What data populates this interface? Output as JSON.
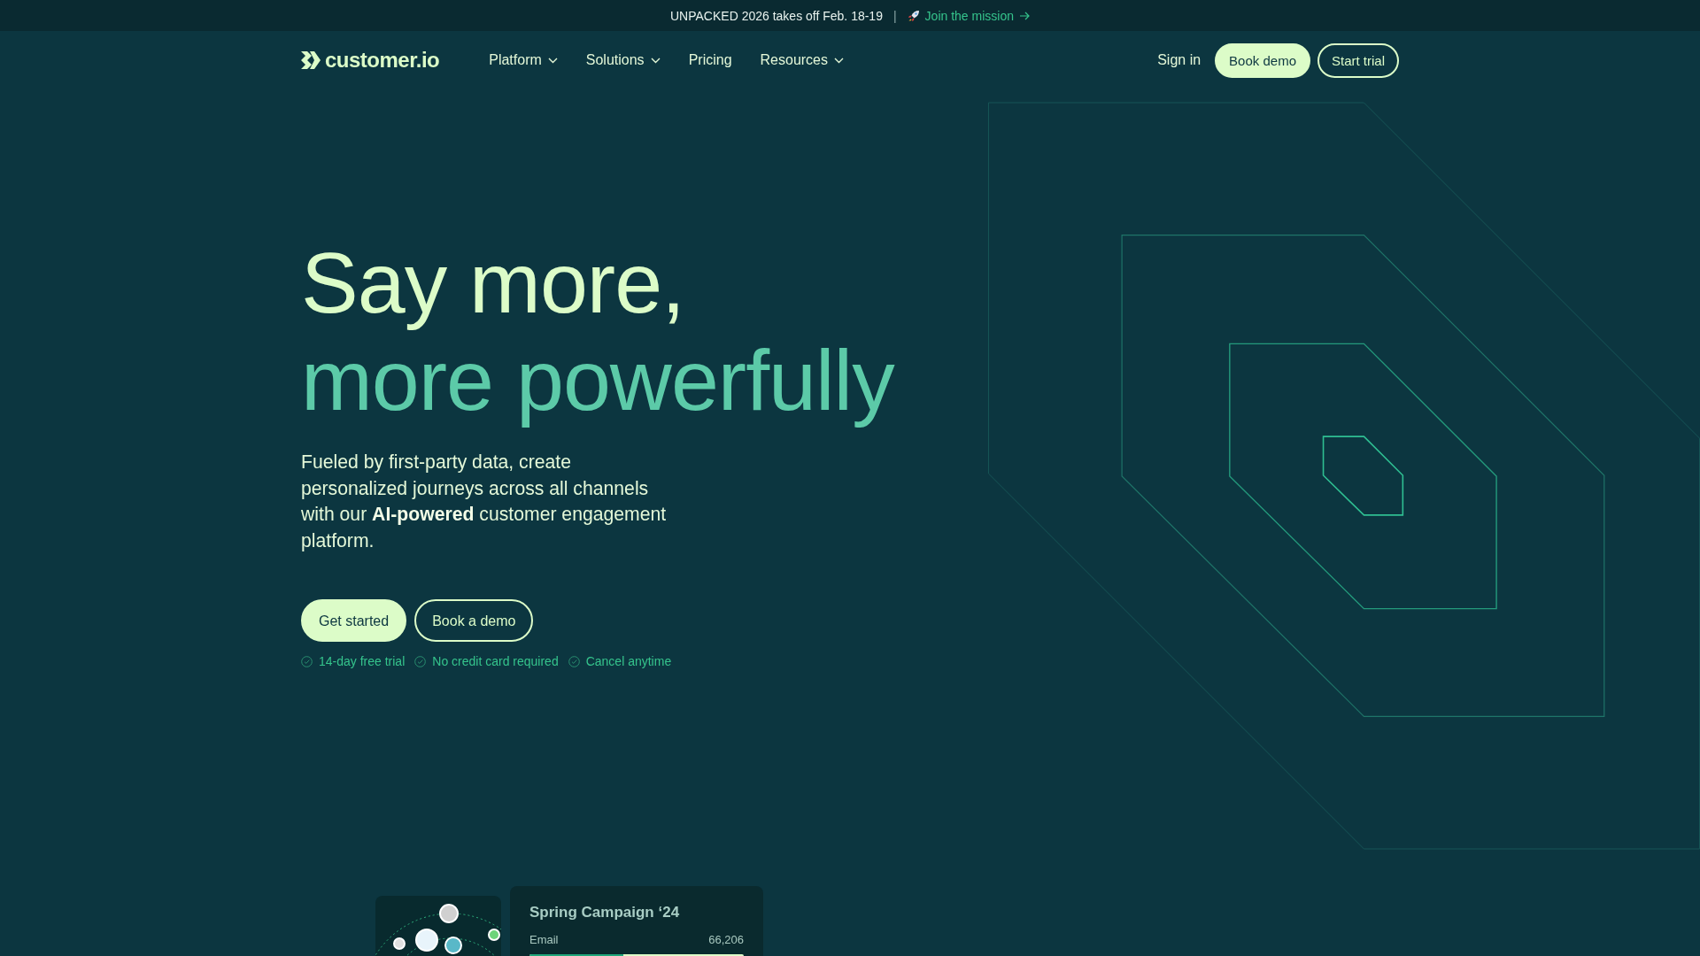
{
  "banner": {
    "text": "UNPACKED 2026 takes off Feb. 18-19",
    "separator": "|",
    "link": "Join the mission"
  },
  "nav": {
    "logo": "customer.io",
    "items": [
      {
        "label": "Platform",
        "dropdown": true
      },
      {
        "label": "Solutions",
        "dropdown": true
      },
      {
        "label": "Pricing",
        "dropdown": false
      },
      {
        "label": "Resources",
        "dropdown": true
      }
    ],
    "sign_in": "Sign in",
    "buttons": [
      {
        "label": "Book demo",
        "kind": "filled"
      },
      {
        "label": "Start trial",
        "kind": "outline"
      }
    ]
  },
  "hero": {
    "title_lines": [
      "Say more,",
      "more powerfully"
    ],
    "description": "Fueled by first-party data, create personalized journeys across all channels with our **AI-powered** customer engagement platform.",
    "buttons": [
      {
        "label": "Get started",
        "kind": "filled"
      },
      {
        "label": "Book a demo",
        "kind": "outline"
      }
    ],
    "perks": [
      "14-day free trial",
      "No credit card required",
      "Cancel anytime"
    ]
  },
  "campaign_card": {
    "title": "Spring Campaign ‘24",
    "channel": "Email",
    "count": "66,206",
    "level": 0.44
  }
}
